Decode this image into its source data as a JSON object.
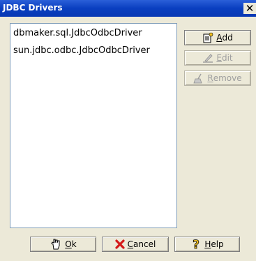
{
  "window": {
    "title": "JDBC Drivers",
    "close_glyph": "✕"
  },
  "drivers": {
    "items": [
      "dbmaker.sql.JdbcOdbcDriver",
      "sun.jdbc.odbc.JdbcOdbcDriver"
    ]
  },
  "side_buttons": {
    "add": {
      "mnemonic": "A",
      "rest": "dd",
      "icon": "add-document-icon",
      "enabled": true
    },
    "edit": {
      "mnemonic": "E",
      "rest": "dit",
      "icon": "edit-pencil-icon",
      "enabled": false
    },
    "remove": {
      "mnemonic": "R",
      "rest": "emove",
      "icon": "remove-broom-icon",
      "enabled": false
    }
  },
  "bottom_buttons": {
    "ok": {
      "mnemonic": "O",
      "rest": "k",
      "icon": "hand-pointer-icon"
    },
    "cancel": {
      "mnemonic": "C",
      "rest": "ancel",
      "icon": "red-x-icon"
    },
    "help": {
      "mnemonic": "H",
      "rest": "elp",
      "icon": "question-mark-icon"
    }
  },
  "colors": {
    "titlebar": "#0a3fc0",
    "dialog_bg": "#ece9d8",
    "disabled_text": "#a0a0a0"
  }
}
